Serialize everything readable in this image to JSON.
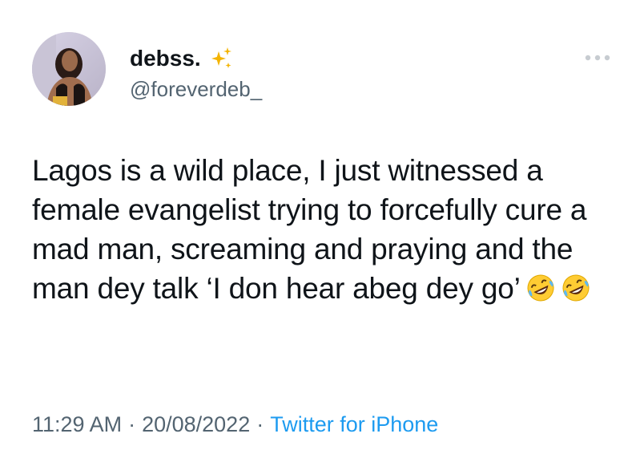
{
  "user": {
    "display_name": "debss.",
    "handle": "@foreverdeb_",
    "badge_icon": "sparkles-icon",
    "avatar_icon": "profile-photo"
  },
  "tweet": {
    "text": "Lagos is a wild place, I just witnessed a female evangelist trying to forcefully cure a mad man, screaming and praying and the man dey talk ‘I don hear abeg dey go’",
    "emojis": [
      "🤣",
      "🤣"
    ]
  },
  "meta": {
    "time": "11:29 AM",
    "separator": "·",
    "date": "20/08/2022",
    "source": "Twitter for iPhone"
  },
  "colors": {
    "text_primary": "#0f1419",
    "text_secondary": "#536471",
    "link": "#1d9bf0",
    "sparkle": "#f4b400"
  },
  "more_icon": "more-options-icon"
}
